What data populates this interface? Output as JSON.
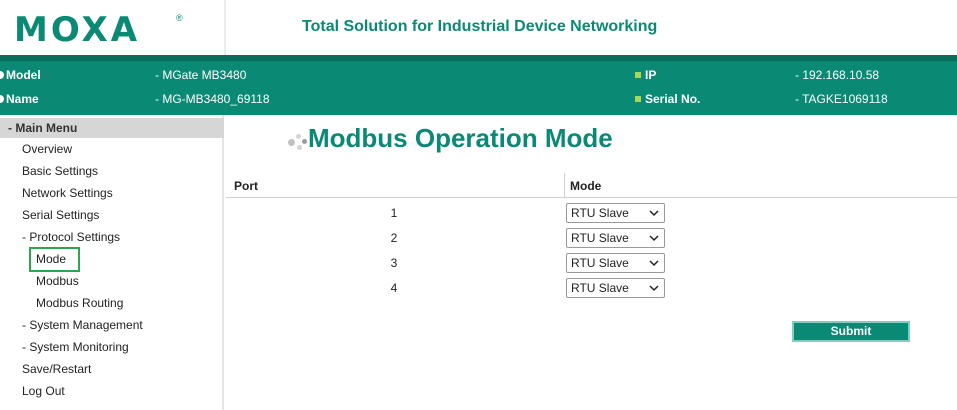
{
  "header": {
    "logo": "MOXA",
    "logo_reg": "®",
    "tagline": "Total Solution for Industrial Device Networking"
  },
  "info": {
    "model_label": "Model",
    "model_value": "- MGate MB3480",
    "name_label": "Name",
    "name_value": "- MG-MB3480_69118",
    "ip_label": "IP",
    "ip_value": "- 192.168.10.58",
    "serial_label": "Serial No.",
    "serial_value": "- TAGKE1069118"
  },
  "sidebar": {
    "head": "- Main Menu",
    "items": [
      "Overview",
      "Basic Settings",
      "Network Settings",
      "Serial Settings",
      "- Protocol Settings",
      "Mode",
      "Modbus",
      "Modbus Routing",
      "- System Management",
      "- System Monitoring",
      "Save/Restart",
      "Log Out"
    ]
  },
  "main": {
    "title": "Modbus Operation Mode",
    "col_port": "Port",
    "col_mode": "Mode",
    "rows": [
      {
        "port": "1",
        "mode": "RTU Slave"
      },
      {
        "port": "2",
        "mode": "RTU Slave"
      },
      {
        "port": "3",
        "mode": "RTU Slave"
      },
      {
        "port": "4",
        "mode": "RTU Slave"
      }
    ],
    "submit": "Submit"
  },
  "colors": {
    "brand": "#0a8a74",
    "highlight": "#2ea44f"
  }
}
